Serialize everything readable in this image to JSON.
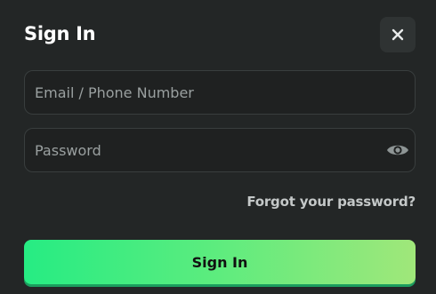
{
  "modal": {
    "title": "Sign In",
    "close_icon": "close-icon"
  },
  "form": {
    "email_placeholder": "Email / Phone Number",
    "email_value": "",
    "password_placeholder": "Password",
    "password_value": "",
    "password_toggle_icon": "eye-icon",
    "forgot_label": "Forgot your password?",
    "submit_label": "Sign In"
  },
  "colors": {
    "background": "#232626",
    "field_background": "#1f2121",
    "field_border": "#393e3e",
    "button_gradient_start": "#26ec83",
    "button_gradient_end": "#a0e77a",
    "title_text": "#ffffff",
    "placeholder_text": "#9aa0a0"
  }
}
